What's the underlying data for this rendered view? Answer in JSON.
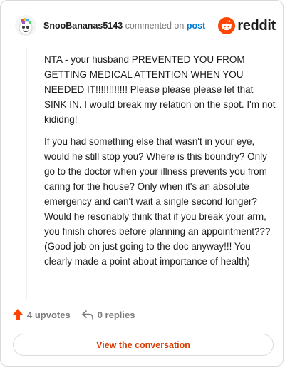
{
  "header": {
    "username": "SnooBananas5143",
    "commented_text": "commented on",
    "post_link": "post",
    "logo_text": "reddit",
    "brand_color": "#ff4500",
    "link_color": "#0079d3"
  },
  "comment": {
    "paragraphs": [
      "NTA - your husband PREVENTED YOU FROM GETTING MEDICAL ATTENTION WHEN YOU NEEDED IT!!!!!!!!!!!! Please please please let that SINK IN. I would break my relation on the spot. I'm not kididng!",
      "If you had something else that wasn't in your eye, would he still stop you? Where is this boundry? Only go to the doctor when your illness prevents you from caring for the house? Only when it's an absolute emergency and can't wait a single second longer? Would he resonably think that if you break your arm, you finish chores before planning an appointment??? (Good job on just going to the doc anyway!!! You clearly made a point about importance of health)"
    ]
  },
  "actions": {
    "upvotes": "4 upvotes",
    "replies": "0 replies",
    "upvote_icon": "upvote-arrow-icon",
    "reply_icon": "reply-arrow-icon"
  },
  "footer": {
    "view_conversation": "View the conversation",
    "button_color": "#d93a00"
  }
}
